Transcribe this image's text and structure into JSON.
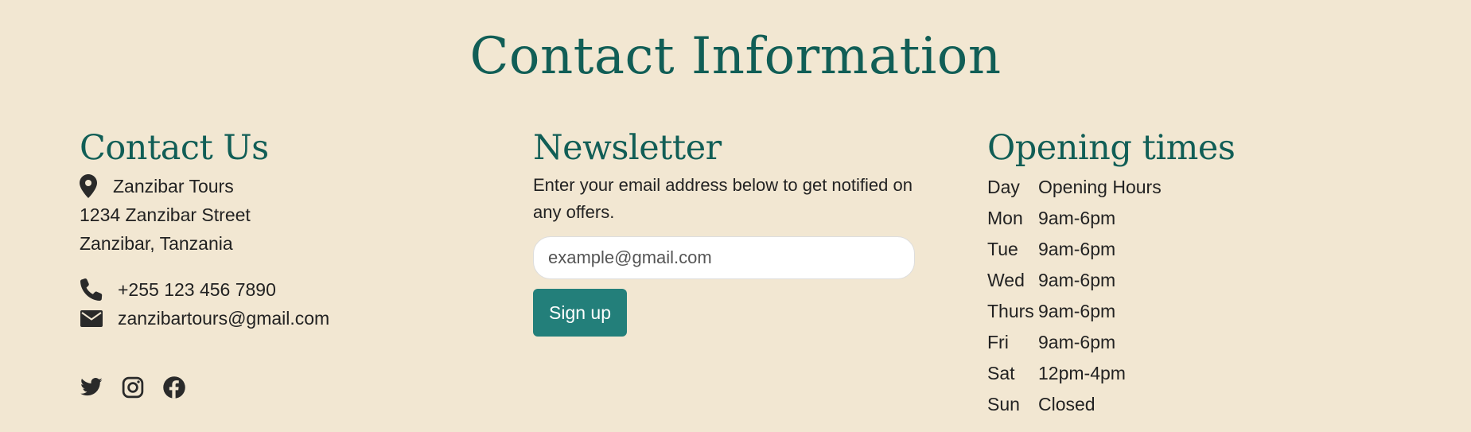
{
  "page": {
    "title": "Contact Information"
  },
  "contact": {
    "title": "Contact Us",
    "address_line1": "Zanzibar Tours",
    "address_line2": "1234 Zanzibar Street",
    "address_line3": "Zanzibar, Tanzania",
    "phone": "+255 123 456 7890",
    "email": "zanzibartours@gmail.com",
    "icons": {
      "address": "map-marker-icon",
      "phone": "phone-icon",
      "email": "envelope-icon"
    },
    "socials": [
      {
        "name": "twitter-icon"
      },
      {
        "name": "instagram-icon"
      },
      {
        "name": "facebook-icon"
      }
    ]
  },
  "newsletter": {
    "title": "Newsletter",
    "description": "Enter your email address below to get notified on any offers.",
    "placeholder": "example@gmail.com",
    "button_label": "Sign up"
  },
  "hours": {
    "title": "Opening times",
    "header": {
      "day": "Day",
      "hours": "Opening Hours"
    },
    "rows": [
      {
        "day": "Mon",
        "hours": "9am-6pm"
      },
      {
        "day": "Tue",
        "hours": "9am-6pm"
      },
      {
        "day": "Wed",
        "hours": "9am-6pm"
      },
      {
        "day": "Thurs",
        "hours": "9am-6pm"
      },
      {
        "day": "Fri",
        "hours": "9am-6pm"
      },
      {
        "day": "Sat",
        "hours": "12pm-4pm"
      },
      {
        "day": "Sun",
        "hours": "Closed"
      }
    ]
  },
  "colors": {
    "background": "#f2e7d2",
    "heading": "#115e56",
    "button": "#237f7a",
    "text": "#222222"
  }
}
